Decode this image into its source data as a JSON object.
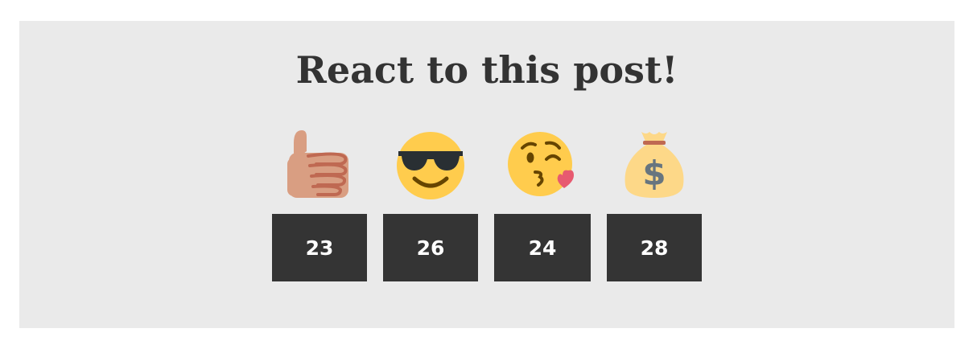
{
  "title": "React to this post!",
  "reactions": [
    {
      "icon": "thumbs-up-icon",
      "count": "23"
    },
    {
      "icon": "sunglasses-face-icon",
      "count": "26"
    },
    {
      "icon": "kissing-face-icon",
      "count": "24"
    },
    {
      "icon": "money-bag-icon",
      "count": "28"
    }
  ],
  "colors": {
    "panel_background": "#eaeaea",
    "counter_background": "#343434",
    "counter_text": "#ffffff",
    "title_text": "#333333"
  }
}
